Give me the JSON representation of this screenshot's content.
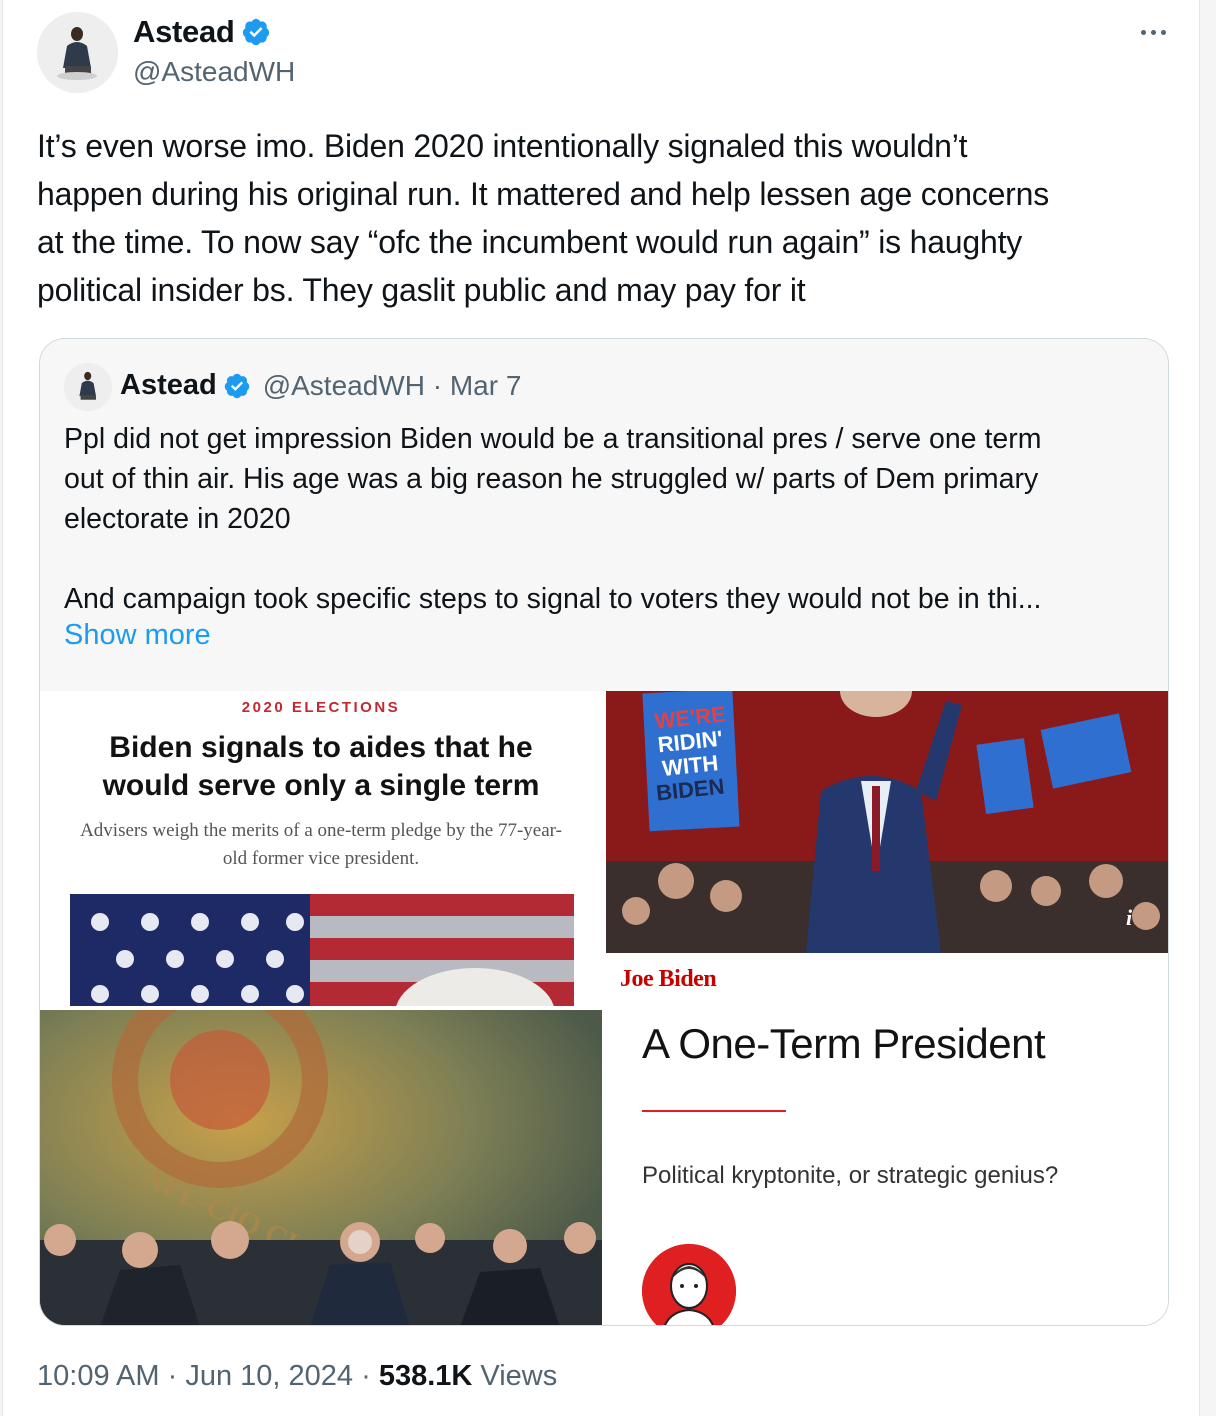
{
  "tweet": {
    "author_name": "Astead",
    "author_handle": "@AsteadWH",
    "text": "It’s even worse imo. Biden 2020 intentionally signaled this wouldn’t\nhappen during his original run. It mattered and help lessen age concerns\nat the time. To now say “ofc the incumbent would run again” is haughty\npolitical insider bs. They gaslit public and may pay for it",
    "time": "10:09 AM",
    "date": "Jun 10, 2024",
    "views_count": "538.1K",
    "views_label": "Views",
    "separator": "·"
  },
  "quote": {
    "author_name": "Astead",
    "meta": "@AsteadWH · Mar 7",
    "text": "Ppl did not get impression Biden would be a transitional pres / serve one term\nout of thin air. His age was a big reason he struggled w/ parts of Dem primary\nelectorate in 2020\n\nAnd campaign took specific steps to signal to voters they would not be in thi...",
    "show_more": "Show more",
    "images": {
      "article1": {
        "kicker": "2020 ELECTIONS",
        "headline": "Biden signals to aides that he would serve only a single term",
        "dek": "Advisers weigh the merits of a one-term pledge by the 77-year-old former vice president."
      },
      "article2": {
        "sign_text": "WE'RE RIDIN' WITH BIDEN",
        "caption": "Joe Biden",
        "info": "i"
      },
      "article3": {
        "logo_text": "AFL-CIO CLC"
      },
      "article4": {
        "title": "A One-Term President",
        "subtitle": "Political kryptonite, or strategic genius?"
      }
    }
  },
  "colors": {
    "link": "#1d9bf0",
    "verified": "#1d9bf0",
    "secondary_text": "#536471",
    "accent_red": "#e01c24"
  },
  "icons": [
    "verified-badge-icon",
    "more-options-icon",
    "info-icon"
  ]
}
